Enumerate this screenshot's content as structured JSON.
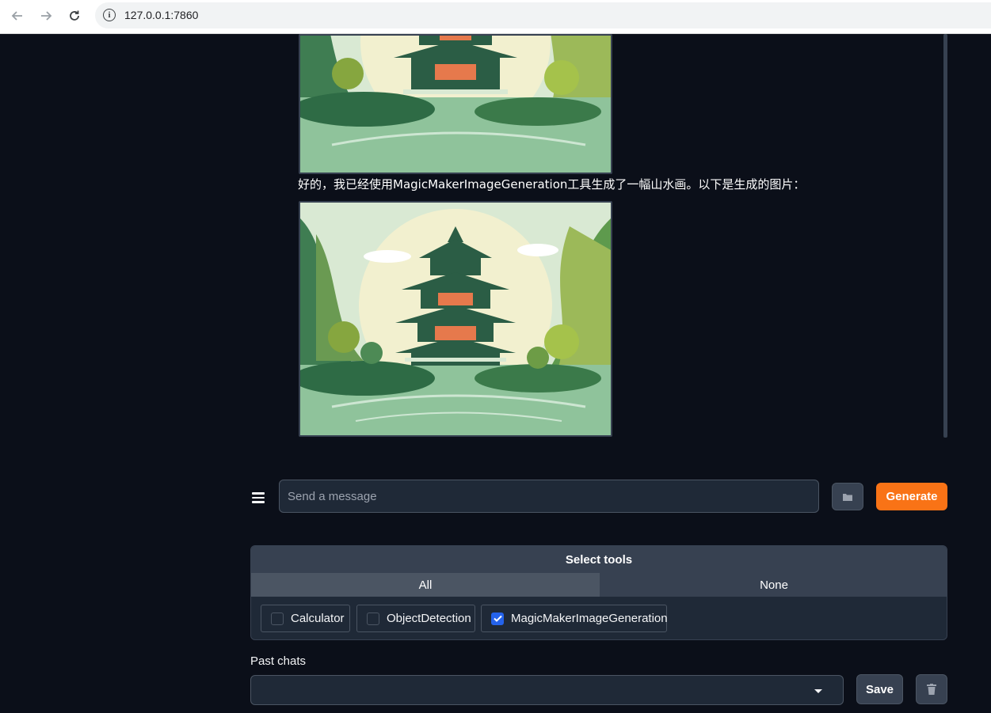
{
  "browser": {
    "url": "127.0.0.1:7860",
    "back_icon": "arrow-left",
    "forward_icon": "arrow-right",
    "reload_icon": "reload",
    "site_info_icon": "info-circle"
  },
  "chat": {
    "bot_message": "好的，我已经使用MagicMakerImageGeneration工具生成了一幅山水画。以下是生成的图片：",
    "images": [
      "generated landscape painting",
      "generated landscape painting"
    ]
  },
  "input": {
    "placeholder": "Send a message",
    "menu_icon": "hamburger",
    "upload_icon": "folder",
    "generate_label": "Generate"
  },
  "tools": {
    "title": "Select tools",
    "all_label": "All",
    "none_label": "None",
    "options": [
      {
        "label": "Calculator",
        "checked": false
      },
      {
        "label": "ObjectDetection",
        "checked": false
      },
      {
        "label": "MagicMakerImageGeneration",
        "checked": true
      }
    ]
  },
  "past_chats": {
    "label": "Past chats",
    "selected": "",
    "save_label": "Save",
    "delete_icon": "trash"
  },
  "colors": {
    "background": "#0b0f19",
    "accent": "#f97316",
    "checkbox": "#2563eb",
    "panel": "#1f2937"
  }
}
